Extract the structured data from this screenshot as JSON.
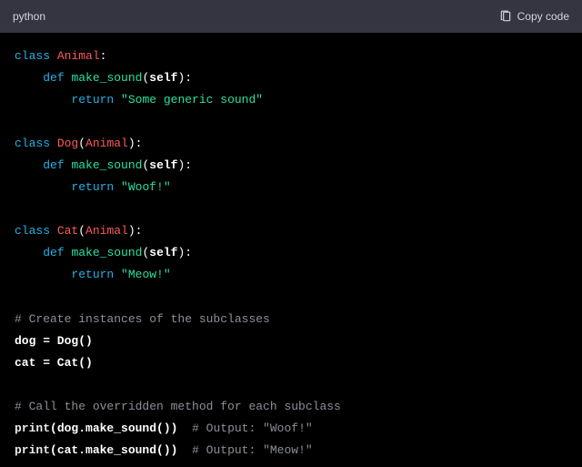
{
  "header": {
    "language": "python",
    "copy_label": "Copy code"
  },
  "code": {
    "kw_class": "class",
    "kw_def": "def",
    "kw_return": "return",
    "cls_animal": "Animal",
    "cls_dog": "Dog",
    "cls_cat": "Cat",
    "fn_make_sound": "make_sound",
    "arg_self": "self",
    "str_generic": "\"Some generic sound\"",
    "str_woof": "\"Woof!\"",
    "str_meow": "\"Meow!\"",
    "comment_instances": "# Create instances of the subclasses",
    "var_dog": "dog",
    "var_cat": "cat",
    "eq_dog": " = Dog()",
    "eq_cat": " = Cat()",
    "comment_call": "# Call the overridden method for each subclass",
    "builtin_print": "print",
    "call_dog": "(dog.make_sound())",
    "comment_woof": "# Output: \"Woof!\"",
    "call_cat": "(cat.make_sound())",
    "comment_meow": "# Output: \"Meow!\"",
    "indent1": "    ",
    "indent2": "        ",
    "colon": ":",
    "lparen": "(",
    "rparen": ")",
    "sp2": "  "
  }
}
